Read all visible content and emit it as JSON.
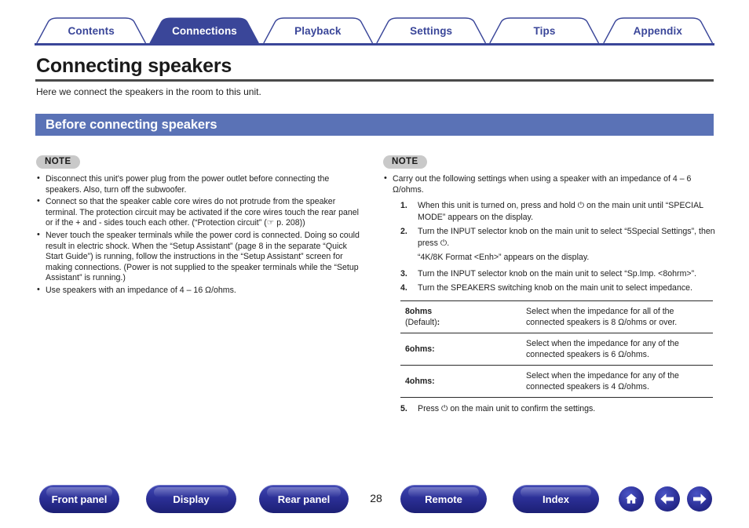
{
  "nav": {
    "tabs": [
      {
        "label": "Contents",
        "active": false
      },
      {
        "label": "Connections",
        "active": true
      },
      {
        "label": "Playback",
        "active": false
      },
      {
        "label": "Settings",
        "active": false
      },
      {
        "label": "Tips",
        "active": false
      },
      {
        "label": "Appendix",
        "active": false
      }
    ],
    "active_color": "#3a4699",
    "inactive_text_color": "#3a4699"
  },
  "page": {
    "title": "Connecting speakers",
    "lead": "Here we connect the speakers in the room to this unit.",
    "section_title": "Before connecting speakers",
    "section_color": "#5a72b6",
    "page_number": "28"
  },
  "left": {
    "note_label": "NOTE",
    "bullets": [
      "Disconnect this unit's power plug from the power outlet before connecting the speakers. Also, turn off the subwoofer.",
      "Connect so that the speaker cable core wires do not protrude from the speaker terminal. The protection circuit may be activated if the core wires touch the rear panel or if the + and - sides touch each other. (“Protection circuit” (☞ p. 208))",
      "Never touch the speaker terminals while the power cord is connected. Doing so could result in electric shock. When the “Setup Assistant” (page 8 in the separate “Quick Start Guide”) is running, follow the instructions in the “Setup Assistant” screen for making connections. (Power is not supplied to the speaker terminals while the “Setup Assistant” is running.)",
      "Use speakers with an impedance of 4 – 16 Ω/ohms."
    ]
  },
  "right": {
    "note_label": "NOTE",
    "intro_bullet": "Carry out the following settings when using a speaker with an impedance of 4 – 6 Ω/ohms.",
    "steps": [
      {
        "num": "1.",
        "text": "When this unit is turned on, press and hold ⏻ on the main unit until “SPECIAL MODE” appears on the display."
      },
      {
        "num": "2.",
        "text": "Turn the INPUT selector knob on the main unit to select “5Special Settings”, then press ⏻."
      }
    ],
    "substep_note": "“4K/8K Format <Enh>” appears on the display.",
    "steps2": [
      {
        "num": "3.",
        "text": "Turn the INPUT selector knob on the main unit to select “Sp.Imp. <8ohrm>”."
      },
      {
        "num": "4.",
        "text": "Turn the SPEAKERS switching knob on the main unit to select impedance."
      }
    ],
    "table": [
      {
        "key": "8ohms",
        "key_sub": "(Default)",
        "key_colon": ":",
        "desc": "Select when the impedance for all of the connected speakers is 8 Ω/ohms or over."
      },
      {
        "key": "6ohms:",
        "key_sub": "",
        "key_colon": "",
        "desc": "Select when the impedance for any of the connected speakers is 6 Ω/ohms."
      },
      {
        "key": "4ohms:",
        "key_sub": "",
        "key_colon": "",
        "desc": "Select when the impedance for any of the connected speakers is 4 Ω/ohms."
      }
    ],
    "final_step": {
      "num": "5.",
      "text": "Press ⏻ on the main unit to confirm the settings."
    }
  },
  "footer": {
    "buttons": [
      {
        "label": "Front panel"
      },
      {
        "label": "Display"
      },
      {
        "label": "Rear panel"
      },
      {
        "label": "Remote"
      },
      {
        "label": "Index"
      }
    ],
    "icons": [
      {
        "name": "home-icon"
      },
      {
        "name": "arrow-left-icon"
      },
      {
        "name": "arrow-right-icon"
      }
    ]
  }
}
